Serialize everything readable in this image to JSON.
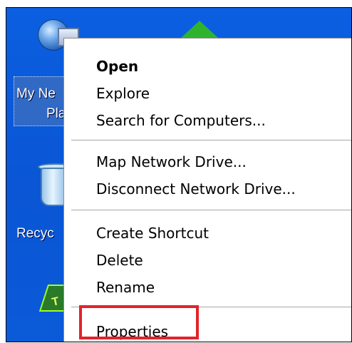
{
  "desktop": {
    "icons": [
      {
        "label": "My Ne",
        "label2": "Pla"
      },
      {
        "label": "Recyc"
      }
    ]
  },
  "menu": {
    "items": [
      {
        "label": "Open",
        "default": true
      },
      {
        "label": "Explore"
      },
      {
        "label": "Search for Computers..."
      },
      {
        "label": "Map Network Drive..."
      },
      {
        "label": "Disconnect Network Drive..."
      },
      {
        "label": "Create Shortcut"
      },
      {
        "label": "Delete"
      },
      {
        "label": "Rename"
      },
      {
        "label": "Properties",
        "highlighted": true
      }
    ]
  },
  "colors": {
    "desktop": "#0a58d8",
    "highlight_box": "#e2232b",
    "menu_bg": "#ffffff"
  }
}
